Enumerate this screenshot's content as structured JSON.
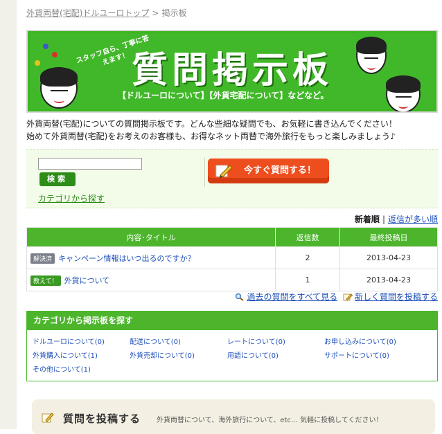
{
  "breadcrumb": {
    "home": "外貨両替(宅配)ドルユーロトップ",
    "separator": ">",
    "current": "掲示板"
  },
  "banner": {
    "title": "質問掲示板",
    "tagline": "スタッフ自ら、丁寧に答えます！",
    "subtitle": "【ドルユーロについて】【外貨宅配について】などなど。"
  },
  "intro": {
    "line1": "外貨両替(宅配)についての質問掲示板です。どんな些細な疑問でも、お気軽に書き込んでください！",
    "line2": "始めて外貨両替(宅配)をお考えのお客様も、お得なネット両替で海外旅行をもっと楽しみましょう♪"
  },
  "search": {
    "input_value": "",
    "button_label": "検索",
    "category_link": "カテゴリから探す",
    "ask_button": "今すぐ質問する！"
  },
  "sort": {
    "current": "新着順",
    "separator": "|",
    "alt": "返信が多い順"
  },
  "table": {
    "headers": [
      "内容･タイトル",
      "返信数",
      "最終投稿日"
    ],
    "rows": [
      {
        "badge": "解決済",
        "badge_type": "solved",
        "title": "キャンペーン情報はいつ出るのですか？",
        "replies": "2",
        "date": "2013-04-23"
      },
      {
        "badge": "教えて！",
        "badge_type": "help",
        "title": "外貨について",
        "replies": "1",
        "date": "2013-04-23"
      }
    ]
  },
  "actions": {
    "all_questions": "過去の質問をすべて見る",
    "new_question": "新しく質問を投稿する"
  },
  "categories": {
    "heading": "カテゴリから掲示板を探す",
    "items": [
      "ドルユーロについて(0)",
      "配送について(0)",
      "レートについて(0)",
      "お申し込みについて(0)",
      "外貨購入について(1)",
      "外貨売却について(0)",
      "用語について(0)",
      "サポートについて(0)",
      "その他について(1)"
    ]
  },
  "post": {
    "title": "質問を投稿する",
    "description": "外貨両替について、海外旅行について、etc… 気軽に投稿してください！"
  },
  "colors": {
    "brand_green": "#4cb52c",
    "ask_orange": "#ee4d1e",
    "link_blue": "#1d4fb8"
  }
}
